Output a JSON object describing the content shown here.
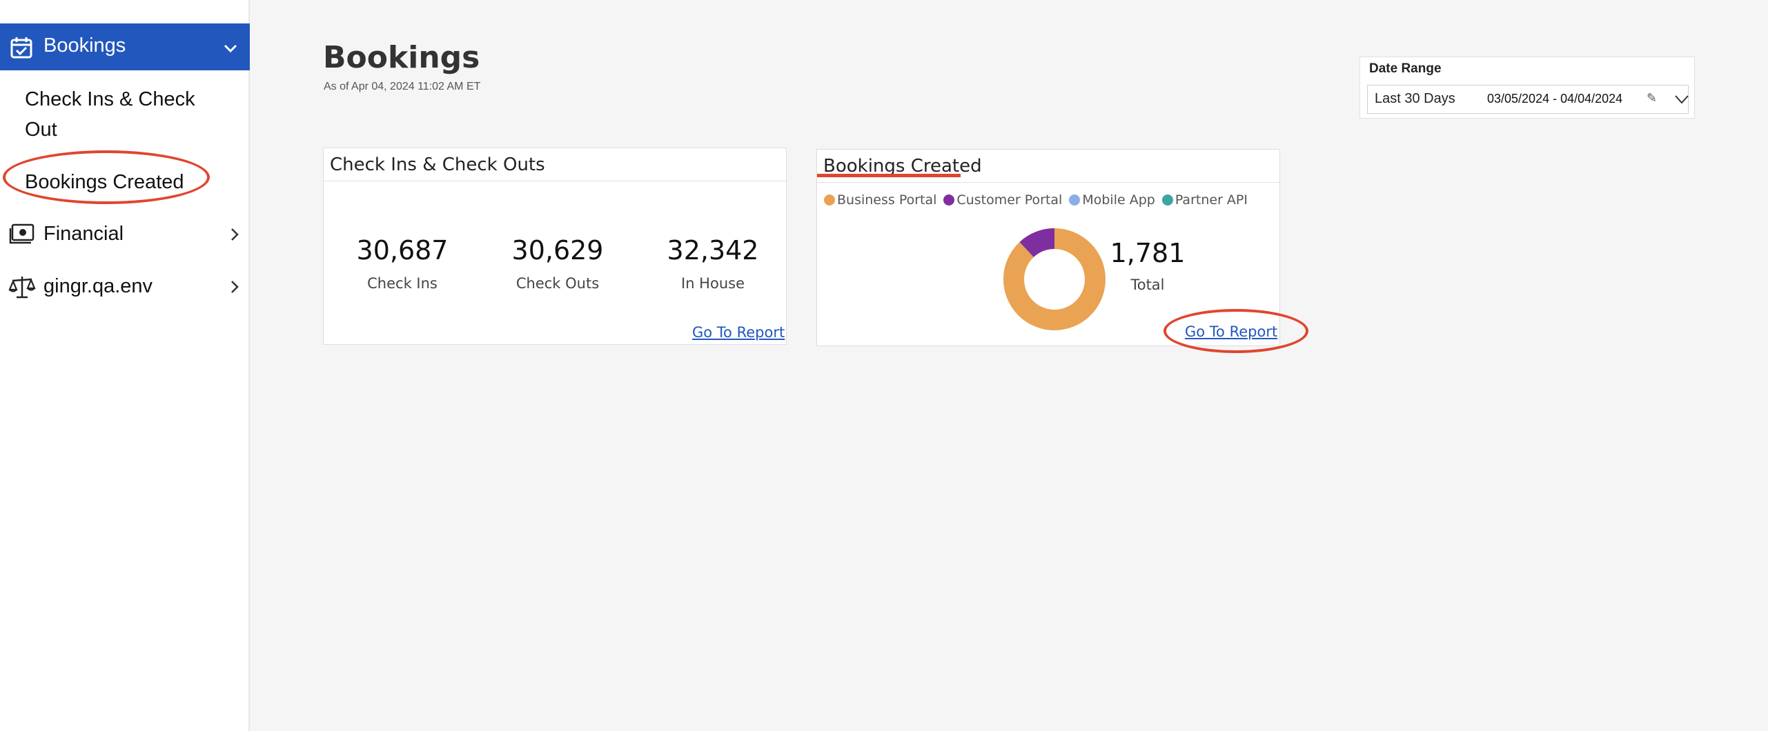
{
  "sidebar": {
    "active": {
      "label": "Bookings",
      "icon": "calendar-check-icon"
    },
    "subitems": [
      {
        "label": "Check Ins & Check Out"
      },
      {
        "label": "Bookings Created"
      }
    ],
    "items": [
      {
        "label": "Financial",
        "icon": "money-icon"
      },
      {
        "label": "gingr.qa.env",
        "icon": "scale-icon"
      }
    ]
  },
  "header": {
    "title": "Bookings",
    "as_of": "As of Apr 04, 2024 11:02 AM ET"
  },
  "date_range": {
    "label": "Date Range",
    "selected": "Last 30 Days",
    "value": "03/05/2024 - 04/04/2024",
    "edit_glyph": "✎"
  },
  "checkins_card": {
    "title": "Check Ins & Check Outs",
    "metrics": [
      {
        "value": "30,687",
        "caption": "Check Ins"
      },
      {
        "value": "30,629",
        "caption": "Check Outs"
      },
      {
        "value": "32,342",
        "caption": "In House"
      }
    ],
    "link": "Go To Report"
  },
  "bookings_card": {
    "title": "Bookings Created",
    "total": "1,781",
    "total_label": "Total",
    "link": "Go To Report"
  },
  "chart_data": {
    "type": "pie",
    "donut": true,
    "legend_position": "top-left",
    "series": [
      {
        "name": "Business Portal",
        "value": 0.88,
        "color": "#eaa352"
      },
      {
        "name": "Customer Portal",
        "value": 0.12,
        "color": "#7f2ea0"
      },
      {
        "name": "Mobile App",
        "value": 0,
        "color": "#8aaee6"
      },
      {
        "name": "Partner API",
        "value": 0,
        "color": "#3aa6a3"
      }
    ]
  },
  "colors": {
    "accent": "#2257bd",
    "annotation": "#e0452e"
  }
}
